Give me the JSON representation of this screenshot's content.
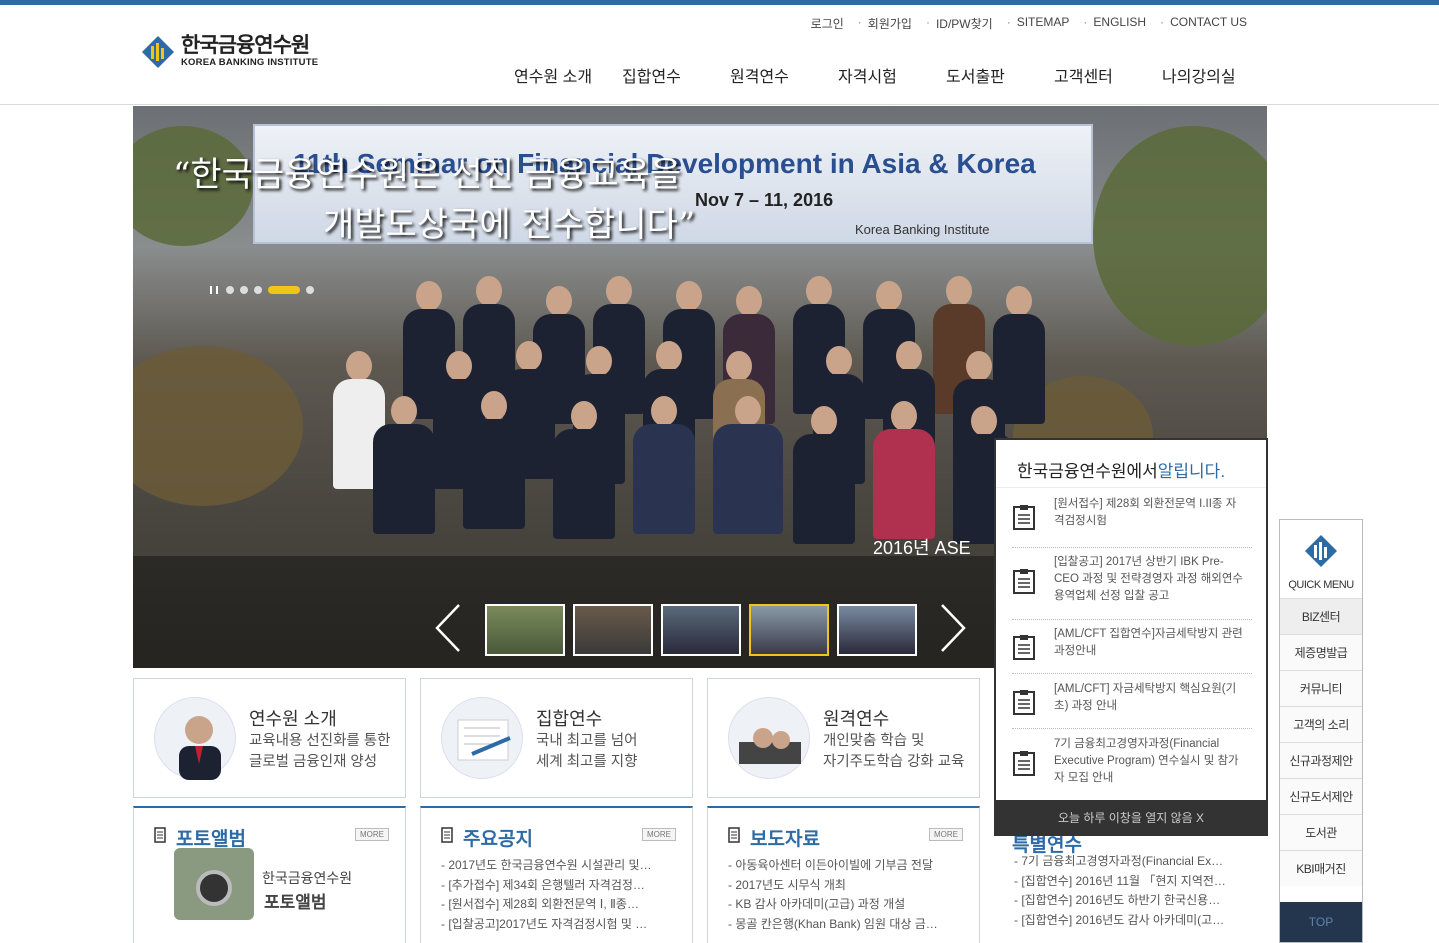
{
  "colors": {
    "brand": "#2d6ba6",
    "highlight": "#f0c419",
    "dark": "#333333"
  },
  "logo": {
    "ko": "한국금융연수원",
    "en": "KOREA BANKING INSTITUTE"
  },
  "util": [
    "로그인",
    "회원가입",
    "ID/PW찾기",
    "SITEMAP",
    "ENGLISH",
    "CONTACT US"
  ],
  "gnb": [
    "연수원 소개",
    "집합연수",
    "원격연수",
    "자격시험",
    "도서출판",
    "고객센터",
    "나의강의실"
  ],
  "hero": {
    "banner_title": "11th Seminar on Financial Development in Asia & Korea",
    "banner_date": "Nov 7 – 11, 2016",
    "banner_org": "Korea Banking Institute",
    "quote_l1": "“한국금융연수원은 선진 금융교육을",
    "quote_l2": "개발도상국에 전수합니다”",
    "caption": "2016년 ASE",
    "slide_count": 6,
    "active_slide": 5
  },
  "notice": {
    "title_a": "한국금융연수원에서",
    "title_b": "알립니다.",
    "items": [
      "[원서접수] 제28회 외환전문역 I.II종 자격검정시험",
      "[입찰공고] 2017년 상반기 IBK Pre-CEO 과정 및 전략경영자 과정 해외연수 용역업체 선정 입찰 공고",
      "[AML/CFT 집합연수]자금세탁방지 관련 과정안내",
      "[AML/CFT] 자금세탁방지 핵심요원(기초) 과정 안내",
      "7기 금융최고경영자과정(Financial Executive Program) 연수실시 및 참가자 모집 안내"
    ],
    "close": "오늘 하루 이창을 열지 않음 X"
  },
  "cards": [
    {
      "title": "연수원 소개",
      "l1": "교육내용 선진화를 통한",
      "l2": "글로벌 금융인재 양성"
    },
    {
      "title": "집합연수",
      "l1": "국내 최고를 넘어",
      "l2": "세계 최고를 지향"
    },
    {
      "title": "원격연수",
      "l1": "개인맞춤 학습 및",
      "l2": "자기주도학습 강화 교육"
    }
  ],
  "panels": {
    "album": {
      "title": "포토앨범",
      "more": "MORE",
      "t1": "한국금융연수원",
      "t2": "포토앨범"
    },
    "notices": {
      "title": "주요공지",
      "more": "MORE",
      "items": [
        "- 2017년도 한국금융연수원 시설관리 및…",
        "- [추가접수] 제34회 은행텔러 자격검정…",
        "- [원서접수] 제28회 외환전문역 Ⅰ, Ⅱ종…",
        "- [입찰공고]2017년도 자격검정시험 및 …"
      ]
    },
    "press": {
      "title": "보도자료",
      "more": "MORE",
      "items": [
        "- 아동육아센터 이든아이빌에 기부금 전달",
        "- 2017년도 시무식 개최",
        "- KB 감사 아카데미(고급) 과정 개설",
        "- 몽골 칸은행(Khan Bank) 임원 대상 금…"
      ]
    },
    "special": {
      "title": "특별연수",
      "items": [
        "- 7기 금융최고경영자과정(Financial Ex…",
        "- [집합연수] 2016년 11월 「현지 지역전…",
        "- [집합연수] 2016년도 하반기 한국신용…",
        "- [집합연수] 2016년도 감사 아카데미(고…"
      ]
    }
  },
  "quick": {
    "title": "QUICK MENU",
    "items": [
      "BIZ센터",
      "제증명발급",
      "커뮤니티",
      "고객의 소리",
      "신규과정제안",
      "신규도서제안",
      "도서관",
      "KBI매거진"
    ],
    "top": "TOP"
  }
}
